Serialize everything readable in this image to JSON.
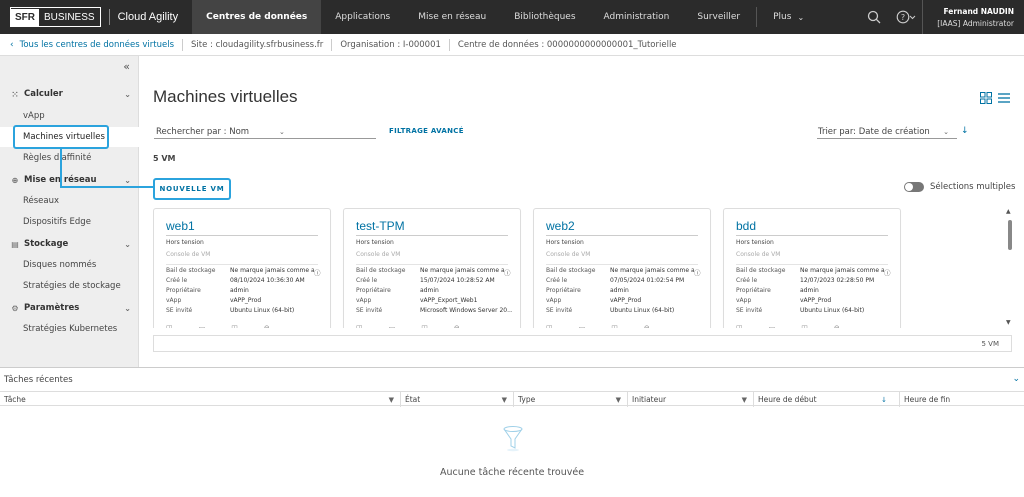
{
  "header": {
    "brand_sfr": "SFR",
    "brand_business": "BUSINESS",
    "app_name": "Cloud Agility",
    "tabs": [
      {
        "label": "Centres de données",
        "active": true
      },
      {
        "label": "Applications"
      },
      {
        "label": "Mise en réseau"
      },
      {
        "label": "Bibliothèques"
      },
      {
        "label": "Administration"
      },
      {
        "label": "Surveiller"
      },
      {
        "label": "Plus"
      }
    ],
    "icons": [
      "search-icon",
      "help-icon"
    ],
    "user_name": "Fernand NAUDIN",
    "user_role": "[IAAS] Administrator"
  },
  "breadcrumb": {
    "back_label": "Tous les centres de données virtuels",
    "site": "Site : cloudagility.sfrbusiness.fr",
    "organisation": "Organisation : I-000001",
    "datacenter": "Centre de données : 0000000000000001_Tutorielle"
  },
  "sidebar": {
    "groups": [
      {
        "label": "Calculer",
        "icon": "compute-icon"
      },
      {
        "label": "Mise en réseau",
        "icon": "network-icon"
      },
      {
        "label": "Stockage",
        "icon": "storage-icon"
      },
      {
        "label": "Paramètres",
        "icon": "settings-icon"
      }
    ],
    "items": [
      {
        "label": "vApp"
      },
      {
        "label": "Machines virtuelles",
        "active": true
      },
      {
        "label": "Règles d'affinité"
      },
      {
        "label": "Réseaux"
      },
      {
        "label": "Dispositifs Edge"
      },
      {
        "label": "Disques nommés"
      },
      {
        "label": "Stratégies de stockage"
      },
      {
        "label": "Stratégies Kubernetes"
      }
    ]
  },
  "main": {
    "title": "Machines virtuelles",
    "search_label": "Rechercher par : Nom",
    "advanced_filter": "FILTRAGE AVANCÉ",
    "sort_label": "Trier par: Date de création",
    "vm_count": "5 VM",
    "new_vm_button": "NOUVELLE VM",
    "multi_select": "Sélections multiples",
    "footer_count": "5 VM",
    "field_labels": {
      "storage": "Bail de stockage",
      "created": "Créé le",
      "owner": "Propriétaire",
      "vapp": "vApp",
      "guest_os": "SE invité",
      "console": "Console de VM"
    },
    "cards": [
      {
        "name": "web1",
        "status": "Hors tension",
        "storage": "Ne marque jamais comme a...",
        "created": "08/10/2024 10:36:30 AM",
        "owner": "admin",
        "vapp": "vAPP_Prod",
        "os": "Ubuntu Linux (64-bit)"
      },
      {
        "name": "test-TPM",
        "status": "Hors tension",
        "storage": "Ne marque jamais comme a...",
        "created": "15/07/2024 10:28:52 AM",
        "owner": "admin",
        "vapp": "vAPP_Export_Web1",
        "os": "Microsoft Windows Server 20..."
      },
      {
        "name": "web2",
        "status": "Hors tension",
        "storage": "Ne marque jamais comme a...",
        "created": "07/05/2024 01:02:54 PM",
        "owner": "admin",
        "vapp": "vAPP_Prod",
        "os": "Ubuntu Linux (64-bit)"
      },
      {
        "name": "bdd",
        "status": "Hors tension",
        "storage": "Ne marque jamais comme a...",
        "created": "12/07/2023 02:28:50 PM",
        "owner": "admin",
        "vapp": "vAPP_Prod",
        "os": "Ubuntu Linux (64-bit)"
      }
    ]
  },
  "tasks": {
    "title": "Tâches récentes",
    "columns": [
      "Tâche",
      "État",
      "Type",
      "Initiateur",
      "Heure de début",
      "Heure de fin"
    ],
    "empty_message": "Aucune tâche récente trouvée"
  },
  "colors": {
    "nav_bg": "#2b2b2b",
    "accent": "#0072a3",
    "annotation": "#2ba3dd",
    "sidebar_bg": "#eeeeee"
  }
}
